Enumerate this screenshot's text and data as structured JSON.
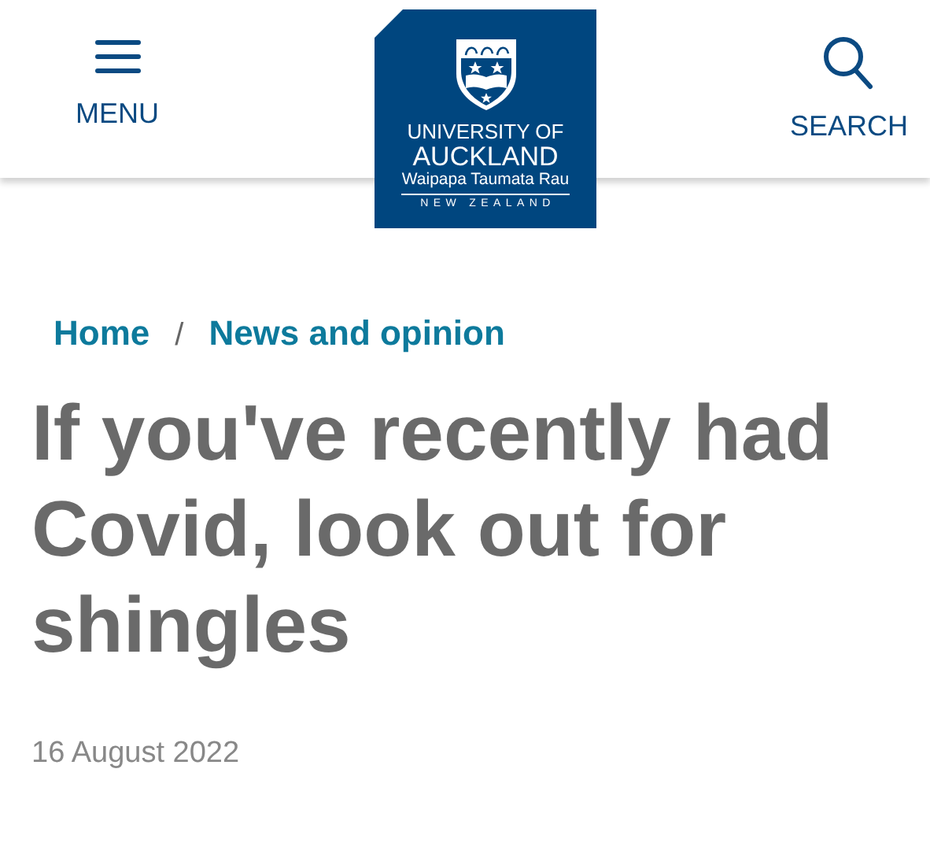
{
  "header": {
    "menu_label": "MENU",
    "search_label": "SEARCH",
    "logo": {
      "lines": [
        "UNIVERSITY OF",
        "AUCKLAND",
        "Waipapa Taumata Rau",
        "NEW ZEALAND"
      ]
    }
  },
  "breadcrumbs": [
    {
      "label": "Home"
    },
    {
      "label": "News and opinion"
    }
  ],
  "breadcrumb_separator": "/",
  "headline": "If you've recently had Covid, look out for shingles",
  "date": "16 August 2022"
}
